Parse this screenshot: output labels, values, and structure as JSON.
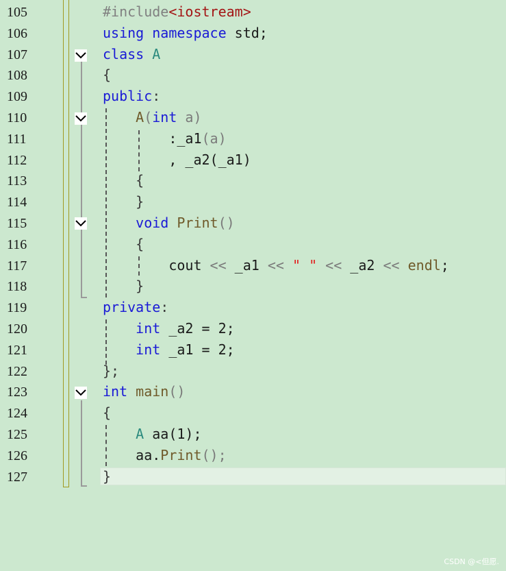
{
  "lines": [
    {
      "num": "105",
      "tokens": [
        {
          "t": "#include",
          "c": "pp"
        },
        {
          "t": "<iostream>",
          "c": "inc"
        }
      ]
    },
    {
      "num": "106",
      "tokens": [
        {
          "t": "using",
          "c": "kw"
        },
        {
          "t": " "
        },
        {
          "t": "namespace",
          "c": "kw"
        },
        {
          "t": " std;",
          "c": "id"
        }
      ]
    },
    {
      "num": "107",
      "tokens": [
        {
          "t": "class",
          "c": "kw"
        },
        {
          "t": " "
        },
        {
          "t": "A",
          "c": "ty"
        }
      ]
    },
    {
      "num": "108",
      "tokens": [
        {
          "t": "{",
          "c": "pu"
        }
      ]
    },
    {
      "num": "109",
      "tokens": [
        {
          "t": "public",
          "c": "kw"
        },
        {
          "t": ":",
          "c": "pu"
        }
      ]
    },
    {
      "num": "110",
      "tokens": [
        {
          "t": "    "
        },
        {
          "t": "A",
          "c": "fn"
        },
        {
          "t": "(",
          "c": "par"
        },
        {
          "t": "int",
          "c": "kw"
        },
        {
          "t": " a",
          "c": "op"
        },
        {
          "t": ")",
          "c": "par"
        }
      ]
    },
    {
      "num": "111",
      "tokens": [
        {
          "t": "        :_a1",
          "c": "id"
        },
        {
          "t": "(",
          "c": "par"
        },
        {
          "t": "a",
          "c": "op"
        },
        {
          "t": ")",
          "c": "par"
        }
      ]
    },
    {
      "num": "112",
      "tokens": [
        {
          "t": "        , _a2(_a1)",
          "c": "id"
        }
      ]
    },
    {
      "num": "113",
      "tokens": [
        {
          "t": "    {",
          "c": "pu"
        }
      ]
    },
    {
      "num": "114",
      "tokens": [
        {
          "t": "    }",
          "c": "pu"
        }
      ]
    },
    {
      "num": "115",
      "tokens": [
        {
          "t": "    "
        },
        {
          "t": "void",
          "c": "kw"
        },
        {
          "t": " "
        },
        {
          "t": "Print",
          "c": "fn"
        },
        {
          "t": "()",
          "c": "par"
        }
      ]
    },
    {
      "num": "116",
      "tokens": [
        {
          "t": "    {",
          "c": "pu"
        }
      ]
    },
    {
      "num": "117",
      "tokens": [
        {
          "t": "        cout ",
          "c": "id"
        },
        {
          "t": "<<",
          "c": "op"
        },
        {
          "t": " _a1 ",
          "c": "id"
        },
        {
          "t": "<<",
          "c": "op"
        },
        {
          "t": " "
        },
        {
          "t": "\" \"",
          "c": "str"
        },
        {
          "t": " "
        },
        {
          "t": "<<",
          "c": "op"
        },
        {
          "t": " _a2 ",
          "c": "id"
        },
        {
          "t": "<<",
          "c": "op"
        },
        {
          "t": " "
        },
        {
          "t": "endl",
          "c": "fn"
        },
        {
          "t": ";",
          "c": "id"
        }
      ]
    },
    {
      "num": "118",
      "tokens": [
        {
          "t": "    }",
          "c": "pu"
        }
      ]
    },
    {
      "num": "119",
      "tokens": [
        {
          "t": "private",
          "c": "kw"
        },
        {
          "t": ":",
          "c": "pu"
        }
      ]
    },
    {
      "num": "120",
      "tokens": [
        {
          "t": "    "
        },
        {
          "t": "int",
          "c": "kw"
        },
        {
          "t": " _a2 = 2;",
          "c": "id"
        }
      ]
    },
    {
      "num": "121",
      "tokens": [
        {
          "t": "    "
        },
        {
          "t": "int",
          "c": "kw"
        },
        {
          "t": " _a1 = 2;",
          "c": "id"
        }
      ]
    },
    {
      "num": "122",
      "tokens": [
        {
          "t": "};",
          "c": "pu"
        }
      ]
    },
    {
      "num": "123",
      "tokens": [
        {
          "t": "int",
          "c": "kw"
        },
        {
          "t": " "
        },
        {
          "t": "main",
          "c": "fn"
        },
        {
          "t": "()",
          "c": "par"
        }
      ]
    },
    {
      "num": "124",
      "tokens": [
        {
          "t": "{",
          "c": "pu"
        }
      ]
    },
    {
      "num": "125",
      "tokens": [
        {
          "t": "    "
        },
        {
          "t": "A",
          "c": "ty"
        },
        {
          "t": " aa(1);",
          "c": "id"
        }
      ]
    },
    {
      "num": "126",
      "tokens": [
        {
          "t": "    aa.",
          "c": "id"
        },
        {
          "t": "Print",
          "c": "fn"
        },
        {
          "t": "();",
          "c": "par"
        }
      ]
    },
    {
      "num": "127",
      "tokens": [
        {
          "t": "}",
          "c": "pu"
        }
      ]
    }
  ],
  "watermark": "CSDN @<但愿."
}
